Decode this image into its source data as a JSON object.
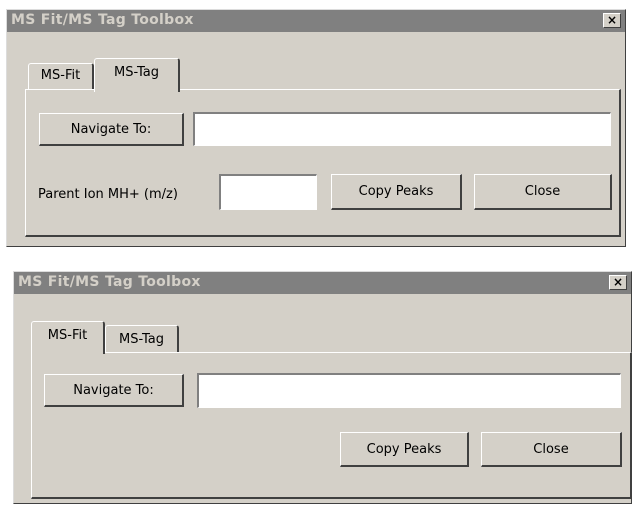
{
  "dialogs": [
    {
      "title": "MS Fit/MS Tag Toolbox",
      "close_glyph": "×",
      "tabs": [
        "MS-Fit",
        "MS-Tag"
      ],
      "active_tab": "MS-Tag",
      "navigate_label": "Navigate To:",
      "navigate_value": "",
      "parent_ion_label": "Parent Ion MH+ (m/z)",
      "parent_ion_value": "",
      "copy_peaks_label": "Copy Peaks",
      "close_label": "Close"
    },
    {
      "title": "MS Fit/MS Tag Toolbox",
      "close_glyph": "×",
      "tabs": [
        "MS-Fit",
        "MS-Tag"
      ],
      "active_tab": "MS-Fit",
      "navigate_label": "Navigate To:",
      "navigate_value": "",
      "copy_peaks_label": "Copy Peaks",
      "close_label": "Close"
    }
  ]
}
